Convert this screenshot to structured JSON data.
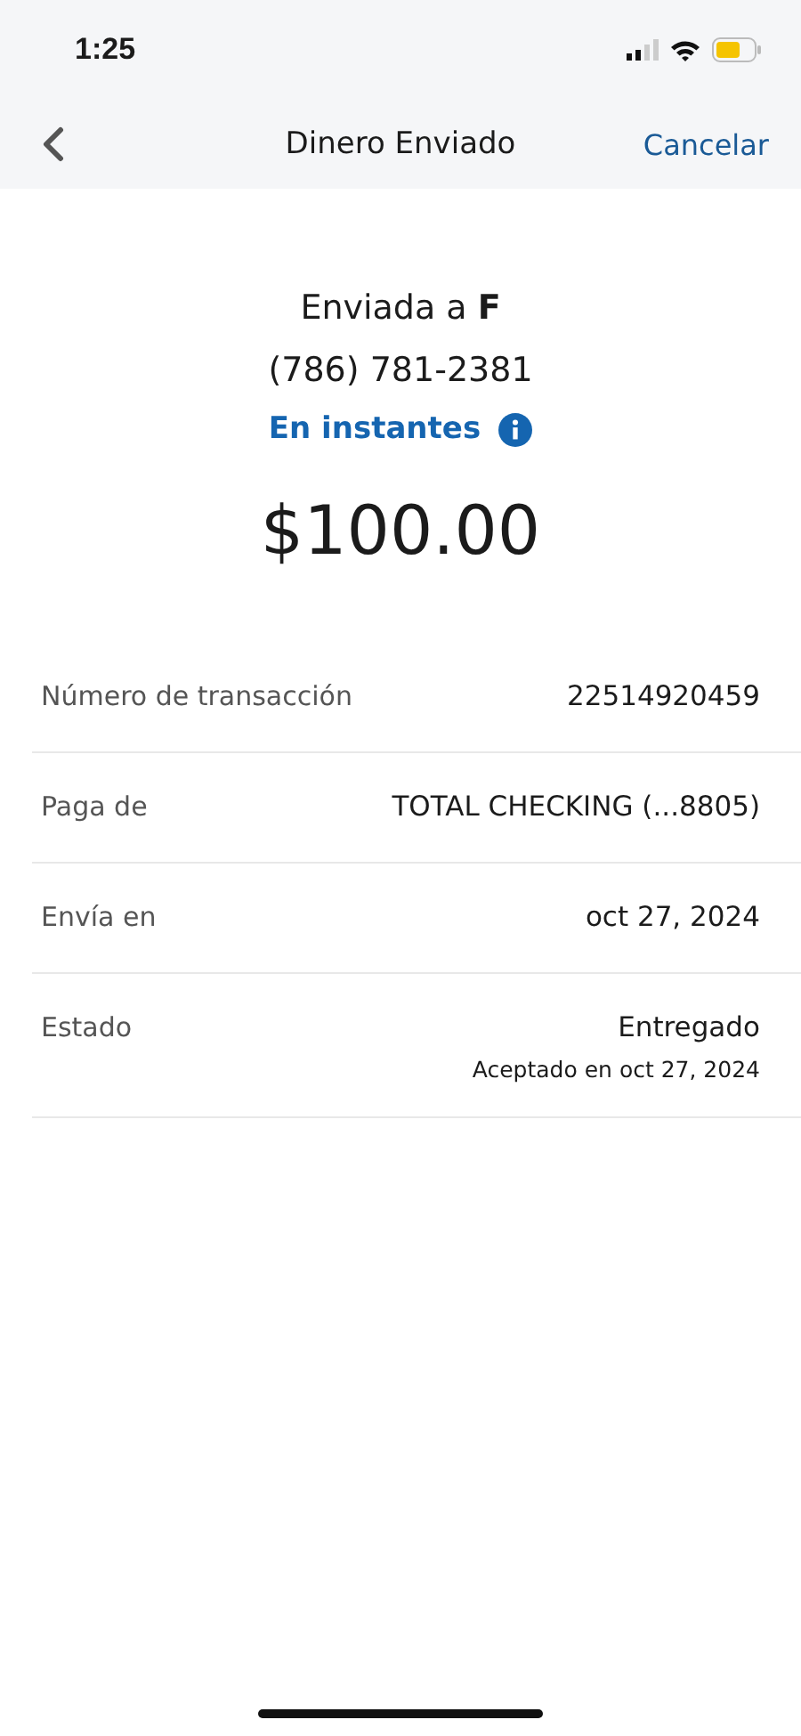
{
  "status_bar": {
    "time": "1:25"
  },
  "nav": {
    "title": "Dinero Enviado",
    "action": "Cancelar"
  },
  "summary": {
    "recipient": "Enviada a **F**",
    "phone": "(786) 781-2381",
    "speed": "En instantes",
    "amount": "$100.00"
  },
  "details": [
    {
      "label": "Número de transacción",
      "value": "22514920459"
    },
    {
      "label": "Paga de",
      "value": "TOTAL CHECKING (...8805)"
    },
    {
      "label": "Envía en",
      "value": "oct 27, 2024"
    },
    {
      "label": "Estado",
      "value": "Entregado",
      "note": "Aceptado en oct 27, 2024"
    }
  ]
}
